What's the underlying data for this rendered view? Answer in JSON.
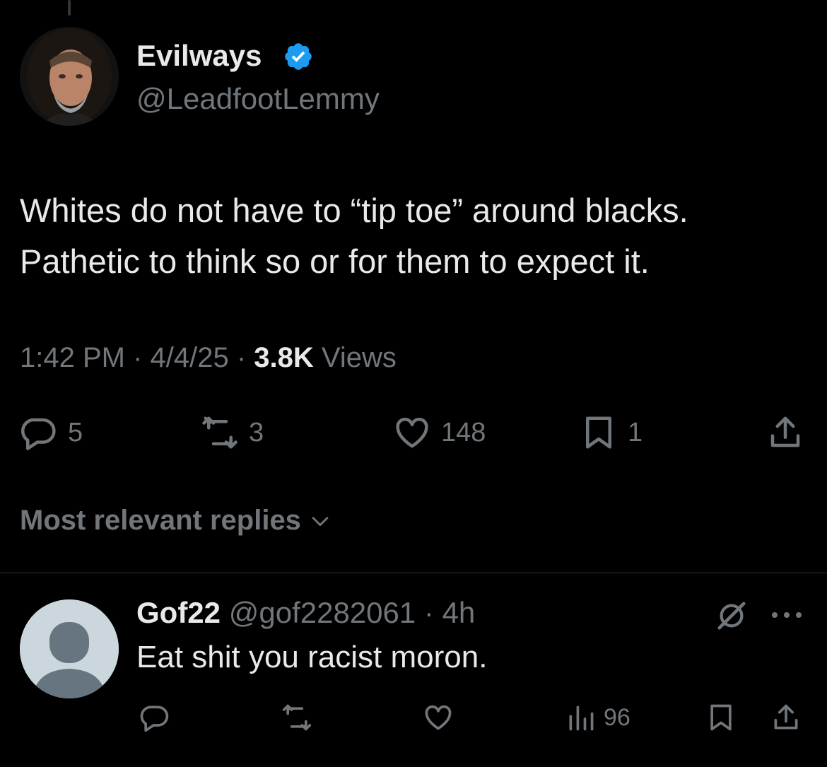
{
  "tweet": {
    "display_name": "Evilways",
    "handle": "@LeadfootLemmy",
    "text_line1": "Whites do not have to “tip toe” around blacks.",
    "text_line2": "Pathetic to think so or for them to expect it.",
    "time": "1:42 PM",
    "sep1": " · ",
    "date": "4/4/25",
    "sep2": " · ",
    "views_count": "3.8K",
    "views_label": " Views",
    "replies": "5",
    "reposts": "3",
    "likes": "148",
    "bookmarks": "1"
  },
  "replies_header": {
    "label": "Most relevant replies"
  },
  "reply": {
    "display_name": "Gof22",
    "handle": " @gof2282061",
    "sep": " · ",
    "age": "4h",
    "text": "Eat shit you racist moron.",
    "views": "96"
  },
  "colors": {
    "background": "#000000",
    "text": "#e7e9ea",
    "secondary": "#71767b",
    "verified": "#1d9bf0",
    "divider": "#2f3336"
  },
  "icons": [
    "reply-icon",
    "repost-icon",
    "like-icon",
    "bookmark-icon",
    "share-icon",
    "verified-badge-icon",
    "chevron-down-icon",
    "grok-icon",
    "more-icon",
    "views-icon"
  ]
}
